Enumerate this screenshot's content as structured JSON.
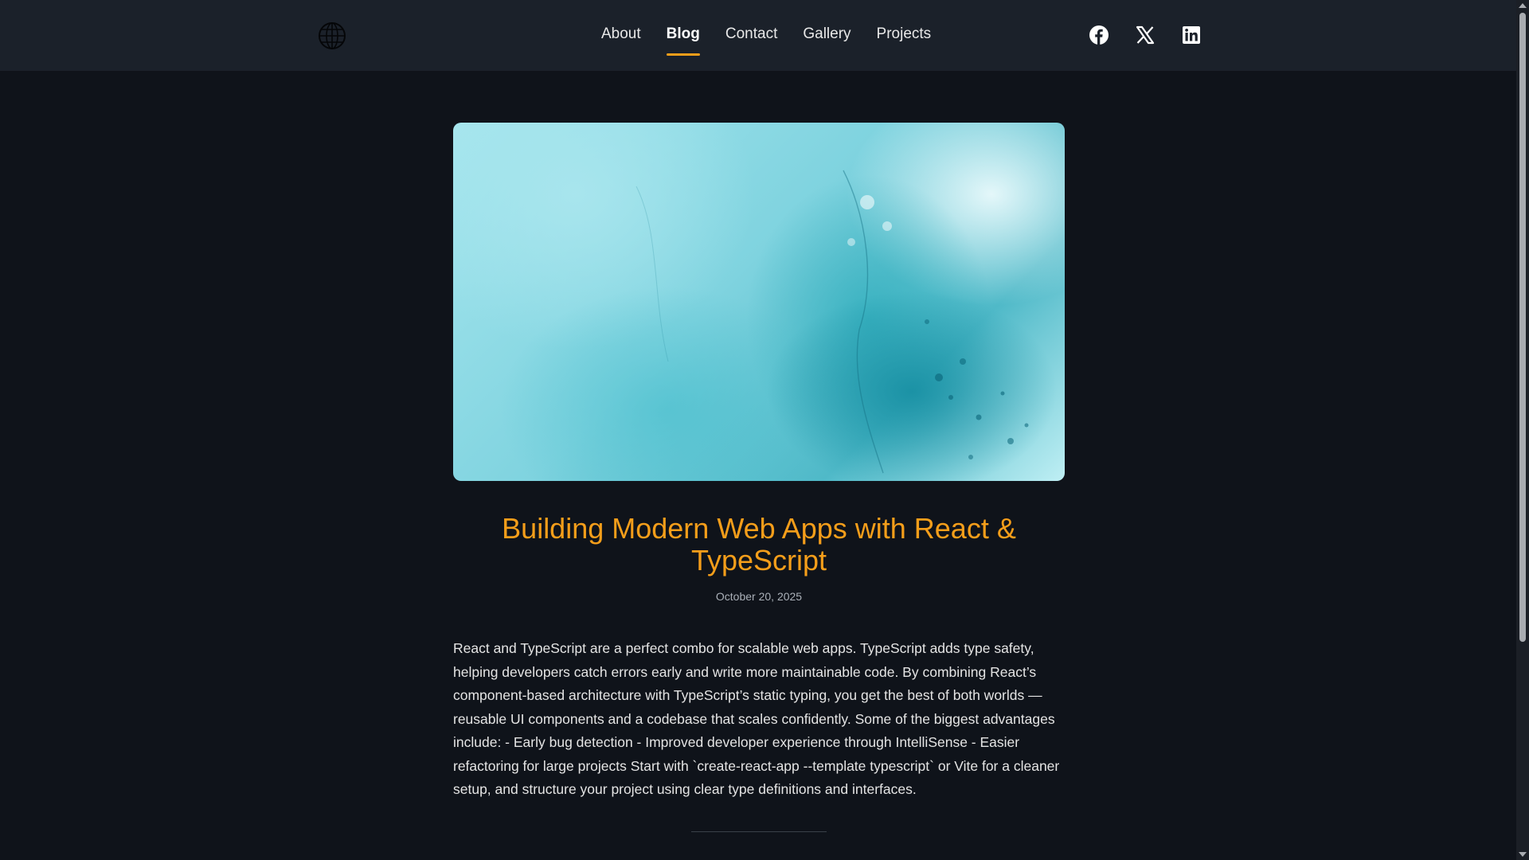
{
  "nav": {
    "items": [
      {
        "label": "About",
        "active": false
      },
      {
        "label": "Blog",
        "active": true
      },
      {
        "label": "Contact",
        "active": false
      },
      {
        "label": "Gallery",
        "active": false
      },
      {
        "label": "Projects",
        "active": false
      }
    ]
  },
  "socials": [
    "facebook-icon",
    "x-icon",
    "linkedin-icon"
  ],
  "post": {
    "title": "Building Modern Web Apps with React & TypeScript",
    "date": "October 20, 2025",
    "body": "React and TypeScript are a perfect combo for scalable web apps. TypeScript adds type safety, helping developers catch errors early and write more maintainable code. By combining React’s component-based architecture with TypeScript’s static typing, you get the best of both worlds — reusable UI components and a codebase that scales confidently. Some of the biggest advantages include: - Early bug detection - Improved developer experience through IntelliSense - Easier refactoring for large projects Start with `create-react-app --template typescript` or Vite for a cleaner setup, and structure your project using clear type definitions and interfaces."
  },
  "colors": {
    "accent": "#f59e1a",
    "background": "#0f131a",
    "header": "#1b212a"
  }
}
